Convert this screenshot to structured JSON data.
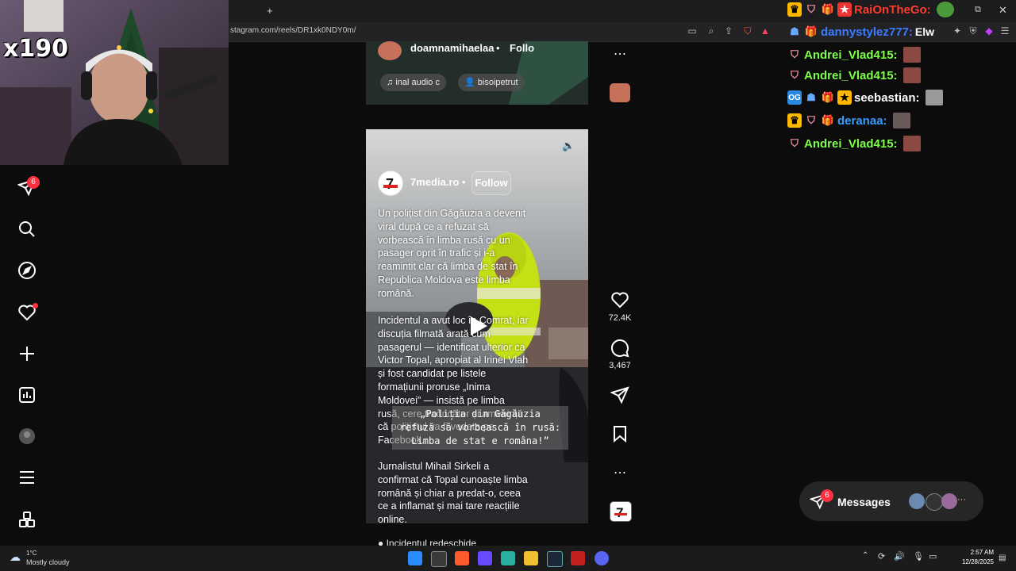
{
  "browser": {
    "url": "stagram.com/reels/DR1xk0NDY0m/",
    "new_tab_label": "+"
  },
  "webcam": {
    "multiplier": "x190"
  },
  "sidebar": {
    "notification_count": "6",
    "items": [
      "direct-icon",
      "search-icon",
      "explore-icon",
      "notifications-icon",
      "create-icon",
      "insights-icon",
      "profile-avatar",
      "more-menu-icon",
      "apps-icon"
    ]
  },
  "reel_top": {
    "username": "doamnamihaelaa",
    "follow": "Follo",
    "audio": "inal audio",
    "audio_suffix": "c",
    "tagged_user": "bisoipetrut"
  },
  "reel": {
    "username": "7media.ro",
    "follow": "Follow",
    "caption_p1": "Un polițist din Găgăuzia a devenit viral după ce a refuzat să vorbească în limba rusă cu un pasager oprit în trafic și i-a reamintit clar că limba de stat în Republica Moldova este limba română.",
    "caption_p2": "Incidentul a avut loc în Comrat, iar discuția filmată arată cum pasagerul — identificat ulterior ca Victor Topal, apropiat al Irinei Vlah și fost candidat pe listele formațiunii proruse „Inima Moldovei” — insistă pe limba rusă, cere traducător și amenință că polițistul va fi vedeta pe Facebook.",
    "caption_p3": "Jurnalistul Mihail Sirkeli a confirmat că Topal cunoaște limba română și chiar a predat-o, ceea ce a inflamat și mai tare reacțiile online.",
    "subtitle_line1": "„Poliția din Găgăuzia",
    "subtitle_line2": "refuză să vorbească în rusă:",
    "subtitle_line3": "Limba de stat e româna!”",
    "next_preview": "Incidentul redeschide",
    "likes": "72.4K",
    "comments": "3,467"
  },
  "chat": [
    {
      "user": "RaiOnTheGo:",
      "color": "#ff3b30"
    },
    {
      "user": "dannystylez777:",
      "color": "#3a7bff",
      "overlay": "Elw"
    },
    {
      "user": "Andrei_Vlad415:",
      "color": "#7dff4a"
    },
    {
      "user": "Andrei_Vlad415:",
      "color": "#7dff4a"
    },
    {
      "user": "seebastian:",
      "color": "#ffffff"
    },
    {
      "user": "deranaa:",
      "color": "#3a9bff"
    },
    {
      "user": "Andrei_Vlad415:",
      "color": "#7dff4a"
    }
  ],
  "messages": {
    "label": "Messages",
    "count": "6",
    "more": "···"
  },
  "taskbar": {
    "temperature": "1°C",
    "weather": "Mostly cloudy",
    "time": "2:57 AM",
    "date": "12/28/2025"
  },
  "colors": {
    "notification_red": "#ff3040",
    "page_bg": "#0c0c0c"
  }
}
